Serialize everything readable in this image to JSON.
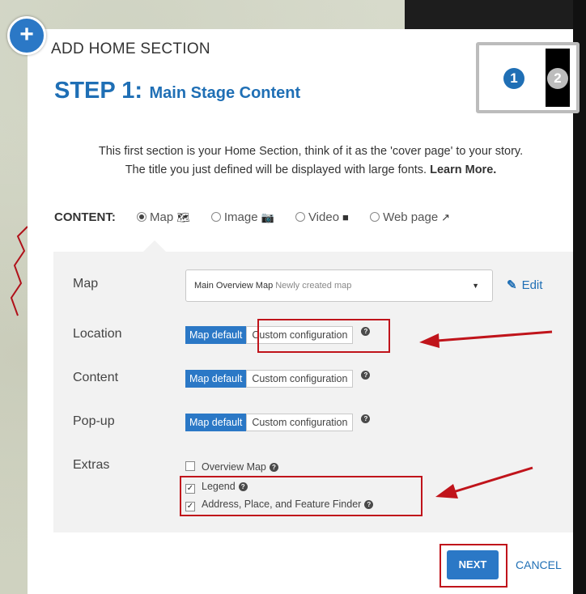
{
  "dialog": {
    "add_icon": "+",
    "title": "ADD HOME SECTION",
    "step_label": "STEP 1:",
    "step_subtitle": "Main Stage Content",
    "step_indicator": [
      "1",
      "2"
    ],
    "intro_line1": "This first section is your Home Section, think of it as the 'cover page' to your story.",
    "intro_line2": "The title you just defined will be displayed with large fonts.",
    "learn_more": "Learn More."
  },
  "content": {
    "label": "CONTENT:",
    "options": [
      {
        "label": "Map",
        "icon": "map-icon",
        "glyph": "🗺",
        "selected": true
      },
      {
        "label": "Image",
        "icon": "camera-icon",
        "glyph": "📷",
        "selected": false
      },
      {
        "label": "Video",
        "icon": "video-icon",
        "glyph": "■",
        "selected": false
      },
      {
        "label": "Web page",
        "icon": "external-link-icon",
        "glyph": "↗",
        "selected": false
      }
    ]
  },
  "form": {
    "map_label": "Map",
    "map_value": "Main Overview Map",
    "map_value_sub": "Newly created map",
    "edit_label": "Edit",
    "location_label": "Location",
    "content_label": "Content",
    "popup_label": "Pop-up",
    "extras_label": "Extras",
    "map_default": "Map default",
    "custom_configuration": "Custom configuration",
    "extras": [
      {
        "label": "Overview Map",
        "checked": false
      },
      {
        "label": "Legend",
        "checked": true
      },
      {
        "label": "Address, Place, and Feature Finder",
        "checked": true
      }
    ]
  },
  "footer": {
    "next_label": "NEXT",
    "cancel_label": "CANCEL"
  },
  "colors": {
    "accent": "#2b78c6",
    "title_blue": "#1f6fb5",
    "annotation_red": "#c0141b",
    "panel_bg": "#f2f2f2"
  }
}
